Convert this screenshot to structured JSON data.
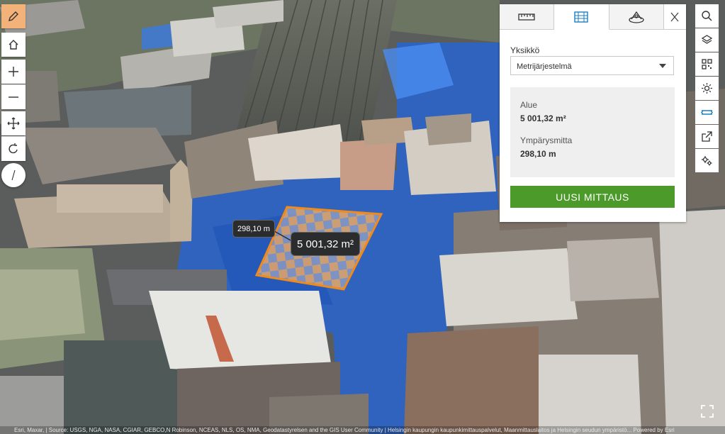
{
  "panel": {
    "tabs": [
      {
        "name": "distance",
        "icon": "ruler-icon"
      },
      {
        "name": "area",
        "icon": "area-measure-icon",
        "active": true
      },
      {
        "name": "elevation",
        "icon": "elevation-icon"
      }
    ],
    "close_icon": "close-icon",
    "unit_label": "Yksikkö",
    "unit_value": "Metrijärjestelmä",
    "area_label": "Alue",
    "area_value": "5 001,32 m²",
    "perimeter_label": "Ympärysmitta",
    "perimeter_value": "298,10 m",
    "new_button": "UUSI MITTAUS"
  },
  "map": {
    "perimeter_label": "298,10 m",
    "area_label": "5 001,32 m²",
    "attribution": "Esri, Maxar, | Source: USGS, NGA, NASA, CGIAR, GEBCO,N Robinson, NCEAS, NLS, OS, NMA, Geodatastyrelsen and the GIS User Community | Helsingin kaupungin kaupunkimittauspalvelut, Maanmittauslaitos ja Helsingin seudun ympäristö... Powered by Esri"
  },
  "left_toolbar": [
    "pencil-icon",
    "home-icon",
    "zoom-in-icon",
    "zoom-out-icon",
    "pan-icon",
    "rotate-icon",
    "compass-icon"
  ],
  "right_toolbar": [
    "search-icon",
    "layers-icon",
    "qr-icon",
    "sun-icon",
    "measure-icon",
    "share-icon",
    "settings-icon"
  ],
  "colors": {
    "accent_green": "#4c9a2a",
    "measure_orange": "#f08a1c",
    "water_blue": "#2a64c8",
    "edit_orange": "#f3b27a"
  }
}
